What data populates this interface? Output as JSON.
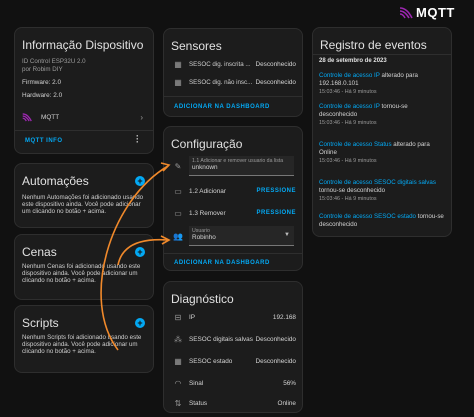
{
  "watermark": "MQTT",
  "device_info": {
    "title": "Informação Dispositivo",
    "line1": "ID Control ESP32U 2.0",
    "line2": "por Robim DIY",
    "firmware": "Firmware: 2.0",
    "hardware": "Hardware: 2.0",
    "integration": "MQTT",
    "mqtt_info": "MQTT INFO"
  },
  "automations": {
    "title": "Automações",
    "text": "Nenhum Automações foi adicionado usando este dispositivo ainda. Você pode adicionar um clicando no botão + acima."
  },
  "scenes": {
    "title": "Cenas",
    "text": "Nenhum Cenas foi adicionado usando este dispositivo ainda. Você pode adicionar um clicando no botão + acima."
  },
  "scripts": {
    "title": "Scripts",
    "text": "Nenhum Scripts foi adicionado usando este dispositivo ainda. Você pode adicionar um clicando no botão + acima."
  },
  "sensors": {
    "title": "Sensores",
    "items": [
      {
        "name": "SESOC dig. inscrita ...",
        "value": "Desconhecido"
      },
      {
        "name": "SESOC dig. não insc...",
        "value": "Desconhecido"
      }
    ],
    "add_link": "ADICIONAR NA DASHBOARD"
  },
  "config": {
    "title": "Configuração",
    "text_label": "1.1 Adicionar e remover usuario da lista",
    "text_value": "unknown",
    "btn1_name": "1.2 Adicionar",
    "btn1_action": "PRESSIONE",
    "btn2_name": "1.3 Remover",
    "btn2_action": "PRESSIONE",
    "select_label": "Usuario",
    "select_value": "Robinho",
    "add_link": "ADICIONAR NA DASHBOARD"
  },
  "diagnostic": {
    "title": "Diagnóstico",
    "items": [
      {
        "name": "IP",
        "value": "192.168"
      },
      {
        "name": "SESOC digitais salvas",
        "value": "Desconhecido"
      },
      {
        "name": "SESOC estado",
        "value": "Desconhecido"
      },
      {
        "name": "Sinal",
        "value": "56%"
      },
      {
        "name": "Status",
        "value": "Online"
      }
    ]
  },
  "events": {
    "title": "Registro de eventos",
    "date": "28 de setembro de 2023",
    "entries": [
      {
        "link": "Controle de acesso IP",
        "rest": " alterado para",
        "value": "192.168.0.101",
        "time": "15:03:46 - Há 9 minutos"
      },
      {
        "link": "Controle de acesso IP",
        "rest": " tornou-se",
        "value": "desconhecido",
        "time": "15:03:46 - Há 9 minutos"
      },
      {
        "link": "Controle de acesso Status",
        "rest": " alterado para",
        "value": "Online",
        "time": "15:03:46 - Há 9 minutos"
      },
      {
        "link": "Controle de acesso SESOC digitais salvas",
        "rest": "",
        "value": "tornou-se desconhecido",
        "time": "15:03:46 - Há 9 minutos"
      },
      {
        "link": "Controle de acesso SESOC estado",
        "rest": " tornou-se",
        "value": "desconhecido",
        "time": ""
      }
    ]
  }
}
